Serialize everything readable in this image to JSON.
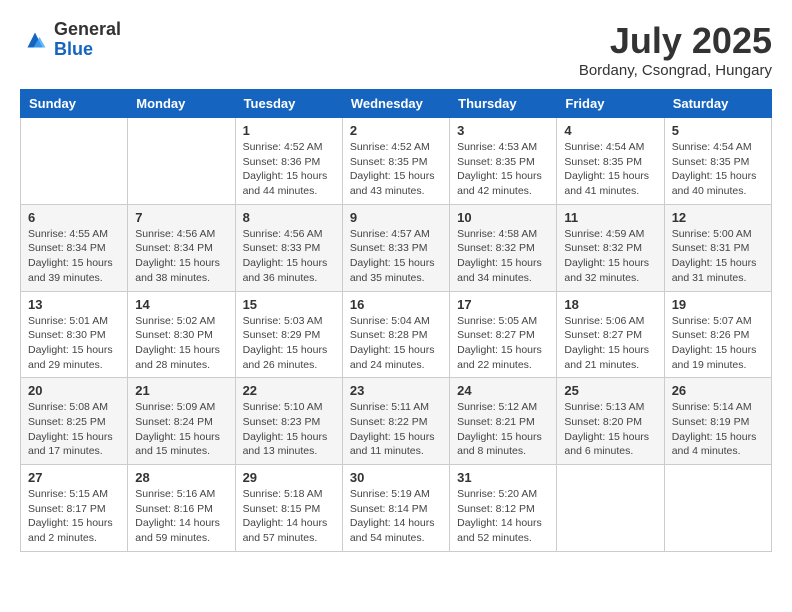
{
  "header": {
    "logo_general": "General",
    "logo_blue": "Blue",
    "month_year": "July 2025",
    "location": "Bordany, Csongrad, Hungary"
  },
  "weekdays": [
    "Sunday",
    "Monday",
    "Tuesday",
    "Wednesday",
    "Thursday",
    "Friday",
    "Saturday"
  ],
  "weeks": [
    [
      {
        "day": "",
        "info": ""
      },
      {
        "day": "",
        "info": ""
      },
      {
        "day": "1",
        "info": "Sunrise: 4:52 AM\nSunset: 8:36 PM\nDaylight: 15 hours and 44 minutes."
      },
      {
        "day": "2",
        "info": "Sunrise: 4:52 AM\nSunset: 8:35 PM\nDaylight: 15 hours and 43 minutes."
      },
      {
        "day": "3",
        "info": "Sunrise: 4:53 AM\nSunset: 8:35 PM\nDaylight: 15 hours and 42 minutes."
      },
      {
        "day": "4",
        "info": "Sunrise: 4:54 AM\nSunset: 8:35 PM\nDaylight: 15 hours and 41 minutes."
      },
      {
        "day": "5",
        "info": "Sunrise: 4:54 AM\nSunset: 8:35 PM\nDaylight: 15 hours and 40 minutes."
      }
    ],
    [
      {
        "day": "6",
        "info": "Sunrise: 4:55 AM\nSunset: 8:34 PM\nDaylight: 15 hours and 39 minutes."
      },
      {
        "day": "7",
        "info": "Sunrise: 4:56 AM\nSunset: 8:34 PM\nDaylight: 15 hours and 38 minutes."
      },
      {
        "day": "8",
        "info": "Sunrise: 4:56 AM\nSunset: 8:33 PM\nDaylight: 15 hours and 36 minutes."
      },
      {
        "day": "9",
        "info": "Sunrise: 4:57 AM\nSunset: 8:33 PM\nDaylight: 15 hours and 35 minutes."
      },
      {
        "day": "10",
        "info": "Sunrise: 4:58 AM\nSunset: 8:32 PM\nDaylight: 15 hours and 34 minutes."
      },
      {
        "day": "11",
        "info": "Sunrise: 4:59 AM\nSunset: 8:32 PM\nDaylight: 15 hours and 32 minutes."
      },
      {
        "day": "12",
        "info": "Sunrise: 5:00 AM\nSunset: 8:31 PM\nDaylight: 15 hours and 31 minutes."
      }
    ],
    [
      {
        "day": "13",
        "info": "Sunrise: 5:01 AM\nSunset: 8:30 PM\nDaylight: 15 hours and 29 minutes."
      },
      {
        "day": "14",
        "info": "Sunrise: 5:02 AM\nSunset: 8:30 PM\nDaylight: 15 hours and 28 minutes."
      },
      {
        "day": "15",
        "info": "Sunrise: 5:03 AM\nSunset: 8:29 PM\nDaylight: 15 hours and 26 minutes."
      },
      {
        "day": "16",
        "info": "Sunrise: 5:04 AM\nSunset: 8:28 PM\nDaylight: 15 hours and 24 minutes."
      },
      {
        "day": "17",
        "info": "Sunrise: 5:05 AM\nSunset: 8:27 PM\nDaylight: 15 hours and 22 minutes."
      },
      {
        "day": "18",
        "info": "Sunrise: 5:06 AM\nSunset: 8:27 PM\nDaylight: 15 hours and 21 minutes."
      },
      {
        "day": "19",
        "info": "Sunrise: 5:07 AM\nSunset: 8:26 PM\nDaylight: 15 hours and 19 minutes."
      }
    ],
    [
      {
        "day": "20",
        "info": "Sunrise: 5:08 AM\nSunset: 8:25 PM\nDaylight: 15 hours and 17 minutes."
      },
      {
        "day": "21",
        "info": "Sunrise: 5:09 AM\nSunset: 8:24 PM\nDaylight: 15 hours and 15 minutes."
      },
      {
        "day": "22",
        "info": "Sunrise: 5:10 AM\nSunset: 8:23 PM\nDaylight: 15 hours and 13 minutes."
      },
      {
        "day": "23",
        "info": "Sunrise: 5:11 AM\nSunset: 8:22 PM\nDaylight: 15 hours and 11 minutes."
      },
      {
        "day": "24",
        "info": "Sunrise: 5:12 AM\nSunset: 8:21 PM\nDaylight: 15 hours and 8 minutes."
      },
      {
        "day": "25",
        "info": "Sunrise: 5:13 AM\nSunset: 8:20 PM\nDaylight: 15 hours and 6 minutes."
      },
      {
        "day": "26",
        "info": "Sunrise: 5:14 AM\nSunset: 8:19 PM\nDaylight: 15 hours and 4 minutes."
      }
    ],
    [
      {
        "day": "27",
        "info": "Sunrise: 5:15 AM\nSunset: 8:17 PM\nDaylight: 15 hours and 2 minutes."
      },
      {
        "day": "28",
        "info": "Sunrise: 5:16 AM\nSunset: 8:16 PM\nDaylight: 14 hours and 59 minutes."
      },
      {
        "day": "29",
        "info": "Sunrise: 5:18 AM\nSunset: 8:15 PM\nDaylight: 14 hours and 57 minutes."
      },
      {
        "day": "30",
        "info": "Sunrise: 5:19 AM\nSunset: 8:14 PM\nDaylight: 14 hours and 54 minutes."
      },
      {
        "day": "31",
        "info": "Sunrise: 5:20 AM\nSunset: 8:12 PM\nDaylight: 14 hours and 52 minutes."
      },
      {
        "day": "",
        "info": ""
      },
      {
        "day": "",
        "info": ""
      }
    ]
  ]
}
